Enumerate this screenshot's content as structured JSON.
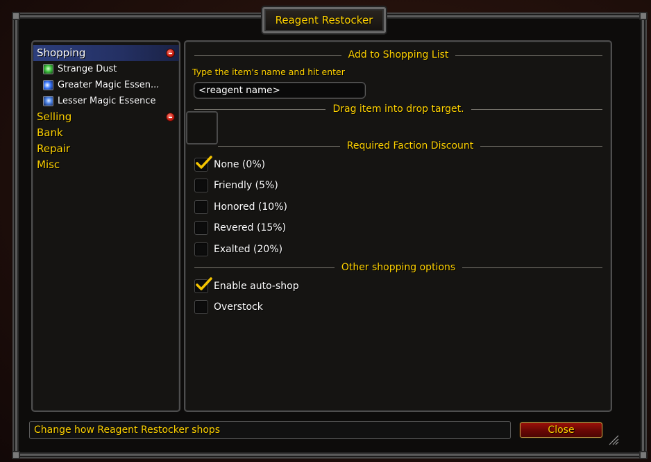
{
  "window": {
    "title": "Reagent Restocker"
  },
  "sidebar": {
    "items": [
      {
        "label": "Shopping",
        "selected": true,
        "collapsible": true
      },
      {
        "label": "Selling",
        "collapsible": true
      },
      {
        "label": "Bank"
      },
      {
        "label": "Repair"
      },
      {
        "label": "Misc"
      }
    ],
    "shopping_children": [
      {
        "label": "Strange Dust",
        "icon": "strange-dust-icon"
      },
      {
        "label": "Greater Magic Essen...",
        "icon": "greater-magic-essence-icon"
      },
      {
        "label": "Lesser Magic Essence",
        "icon": "lesser-magic-essence-icon"
      }
    ]
  },
  "main": {
    "sections": {
      "add_to_list": "Add to Shopping List",
      "drag_item": "Drag item into drop target.",
      "faction_discount": "Required Faction Discount",
      "other_options": "Other shopping options"
    },
    "name_hint": "Type the item's name and hit enter",
    "reagent_input_value": "<reagent name>",
    "faction_options": [
      {
        "label": "None (0%)",
        "checked": true
      },
      {
        "label": "Friendly (5%)",
        "checked": false
      },
      {
        "label": "Honored (10%)",
        "checked": false
      },
      {
        "label": "Revered (15%)",
        "checked": false
      },
      {
        "label": "Exalted (20%)",
        "checked": false
      }
    ],
    "other_options": [
      {
        "label": "Enable auto-shop",
        "checked": true
      },
      {
        "label": "Overstock",
        "checked": false
      }
    ]
  },
  "footer": {
    "status_text": "Change how Reagent Restocker shops",
    "close_label": "Close"
  },
  "colors": {
    "gold_text": "#ffd200",
    "selected_bg": "#2c3e7c",
    "close_button": "#6a0805"
  }
}
